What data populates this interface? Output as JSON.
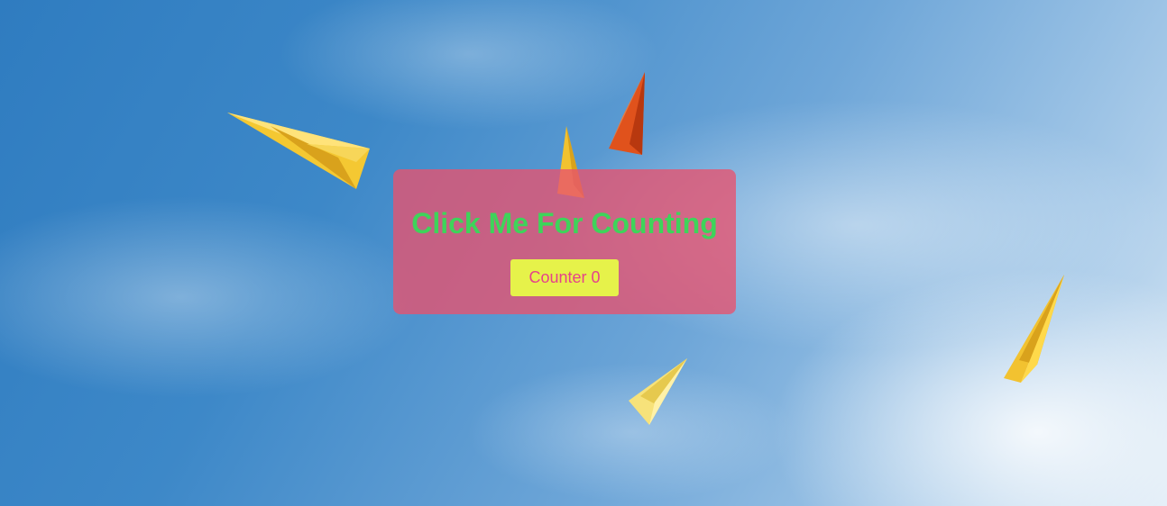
{
  "page": {
    "background": "sky-with-paper-planes"
  },
  "card": {
    "title": "Click Me For Counting",
    "title_color": "#3ed45a",
    "panel_color": "#e8526e",
    "button_label": "Counter 0",
    "button_bg": "#e6f24a",
    "button_text_color": "#e6428a"
  },
  "decor": {
    "planes": [
      {
        "name": "paper-plane-yellow-large-icon",
        "color": "#f2c230"
      },
      {
        "name": "paper-plane-orange-icon",
        "color": "#e0521c"
      },
      {
        "name": "paper-plane-yellow-small-icon",
        "color": "#f2c230"
      },
      {
        "name": "paper-plane-pale-yellow-icon",
        "color": "#f7e27a"
      },
      {
        "name": "paper-plane-yellow-right-icon",
        "color": "#f2c230"
      }
    ]
  }
}
